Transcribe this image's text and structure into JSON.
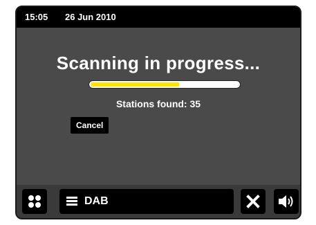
{
  "status_bar": {
    "time": "15:05",
    "date": "26 Jun 2010"
  },
  "scan": {
    "title": "Scanning in progress...",
    "progress_fraction": 0.6,
    "progress_color": "#ffe400",
    "stations_found_text": "Stations found: 35",
    "cancel_label": "Cancel"
  },
  "bottom_bar": {
    "menu_icon": "grid-dots-icon",
    "source_icon": "list-icon",
    "source_label": "DAB",
    "close_icon": "close-icon",
    "volume_icon": "speaker-volume-icon"
  }
}
